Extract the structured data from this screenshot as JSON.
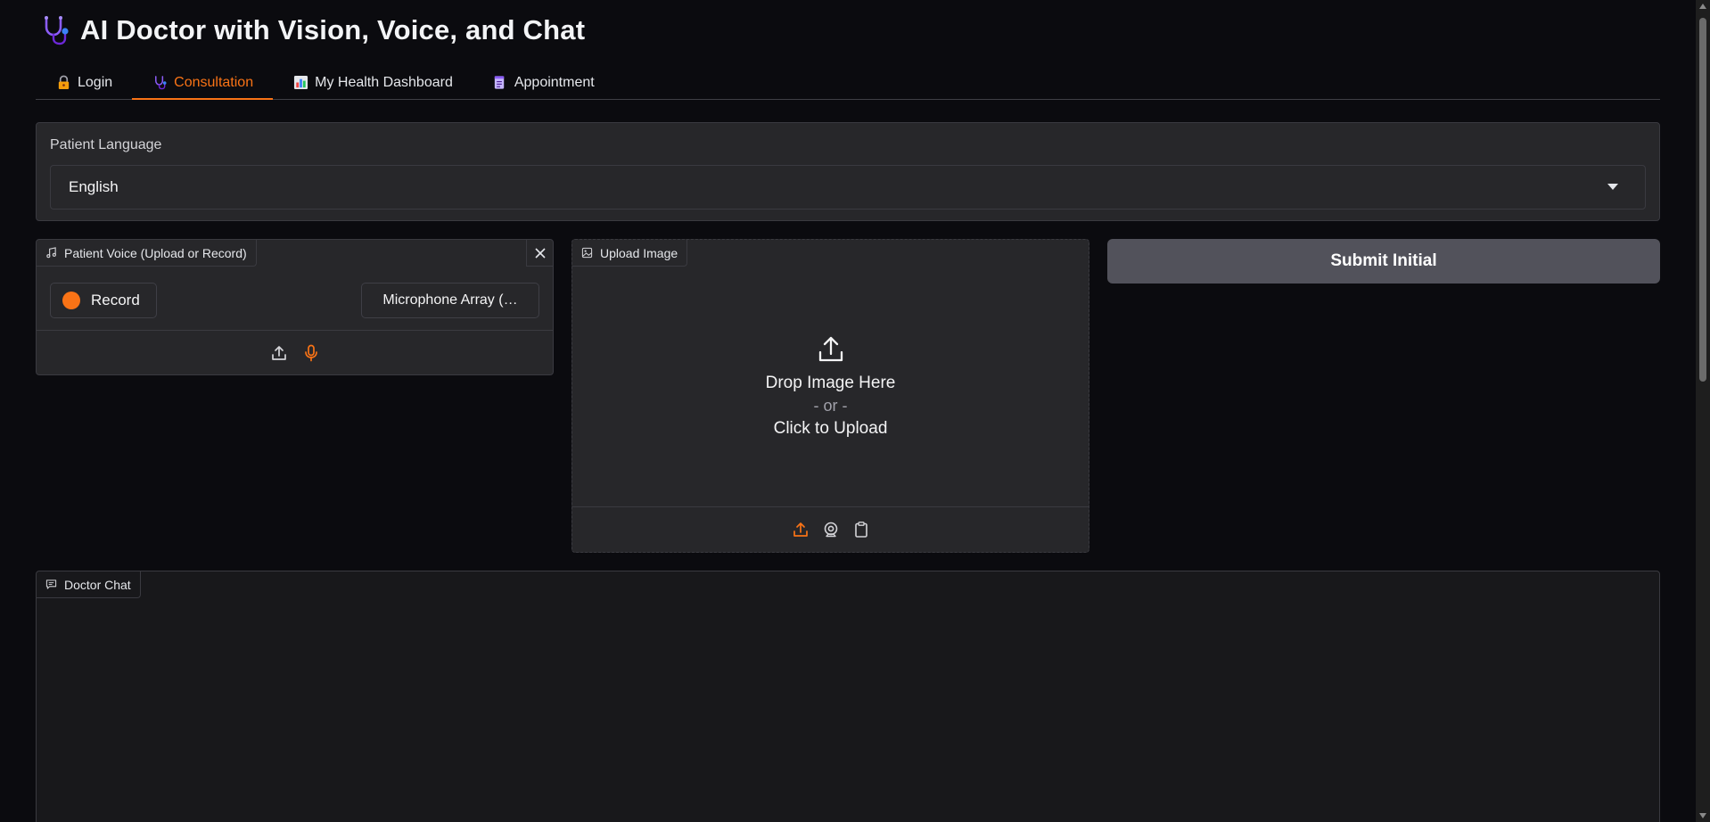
{
  "app": {
    "title": "AI Doctor with Vision, Voice, and Chat",
    "title_icon": "stethoscope-icon"
  },
  "tabs": [
    {
      "label": "Login",
      "icon": "lock-icon",
      "active": false
    },
    {
      "label": "Consultation",
      "icon": "stethoscope-icon",
      "active": true
    },
    {
      "label": "My Health Dashboard",
      "icon": "bar-chart-icon",
      "active": false
    },
    {
      "label": "Appointment",
      "icon": "scroll-icon",
      "active": false
    }
  ],
  "language": {
    "label": "Patient Language",
    "selected": "English"
  },
  "voice": {
    "label": "Patient Voice (Upload or Record)",
    "record_label": "Record",
    "mic_device": "Microphone Array (…"
  },
  "image_upload": {
    "label": "Upload Image",
    "drop_text": "Drop Image Here",
    "or_text": "- or -",
    "click_text": "Click to Upload"
  },
  "submit": {
    "label": "Submit Initial"
  },
  "chat": {
    "label": "Doctor Chat"
  },
  "colors": {
    "accent": "#f97316",
    "background": "#0b0b0f",
    "panel": "#27272a",
    "button": "#52525b"
  }
}
